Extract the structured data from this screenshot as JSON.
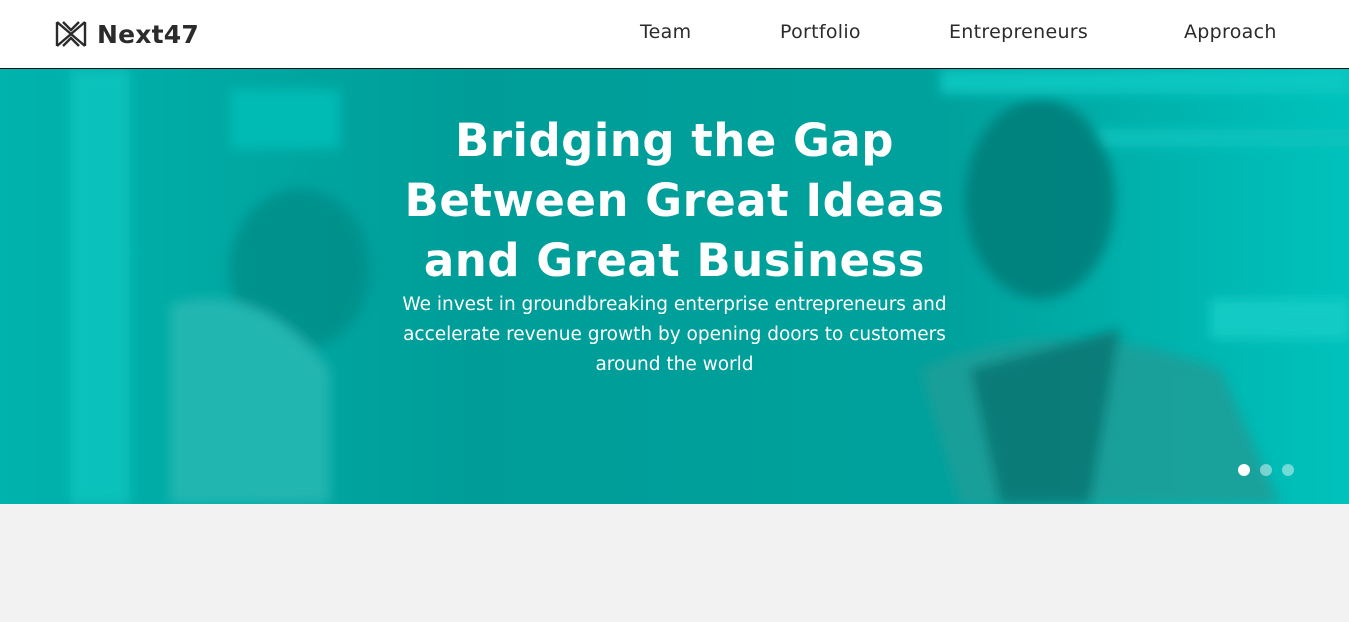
{
  "header": {
    "logo_text": "Next47",
    "nav": [
      {
        "label": "Team"
      },
      {
        "label": "Portfolio"
      },
      {
        "label": "Entrepreneurs"
      },
      {
        "label": "Approach"
      }
    ]
  },
  "hero": {
    "title_lines": [
      "Bridging the Gap",
      "Between Great Ideas",
      "and Great Business"
    ],
    "subtitle_lines": [
      "We invest in groundbreaking enterprise entrepreneurs and",
      "accelerate revenue growth by opening doors to customers",
      "around the world"
    ],
    "slide_count": 3,
    "active_slide": 1
  },
  "colors": {
    "hero_teal": "#00a8a3",
    "text_dark": "#2b2b2b",
    "page_bg": "#f2f2f2"
  },
  "icons": {
    "logo": "next47-logo-icon"
  }
}
